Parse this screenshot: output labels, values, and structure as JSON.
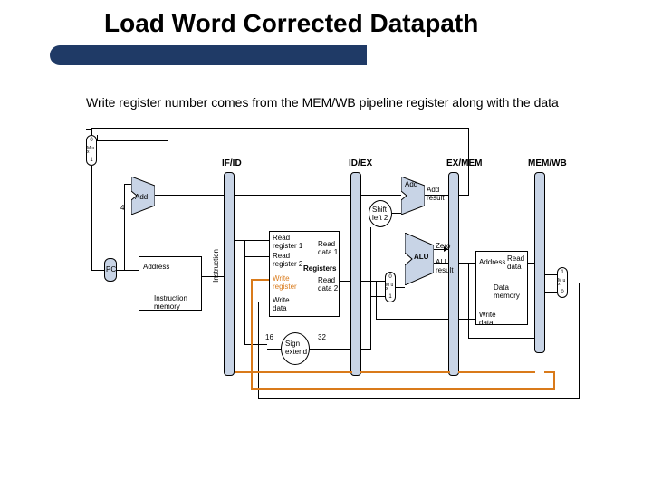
{
  "title": "Load Word Corrected Datapath",
  "subtitle": "Write register number comes from the MEM/WB pipeline register along with the data",
  "pipes": {
    "if_id": "IF/ID",
    "id_ex": "ID/EX",
    "ex_mem": "EX/MEM",
    "mem_wb": "MEM/WB"
  },
  "labels": {
    "pc": "PC",
    "add1": "Add",
    "add2": "Add",
    "add_result": "Add\nresult",
    "mux0": "0",
    "mux1": "1",
    "mux_m": "M\nu\nx",
    "four": "4",
    "address": "Address",
    "instruction": "Instruction",
    "instr_mem": "Instruction\nmemory",
    "shift_left": "Shift\nleft 2",
    "read_reg1": "Read\nregister 1",
    "read_reg2": "Read\nregister 2",
    "write_reg": "Write\nregister",
    "write_data": "Write\ndata",
    "registers": "Registers",
    "read_data1": "Read\ndata 1",
    "read_data2": "Read\ndata 2",
    "sixteen": "16",
    "thirtytwo": "32",
    "sign_ext": "Sign\nextend",
    "zero": "Zero",
    "alu": "ALU",
    "alu_result": "ALU\nresult",
    "address2": "Address",
    "data_mem": "Data\nmemory",
    "read_data": "Read\ndata",
    "write_data2": "Write\ndata"
  }
}
